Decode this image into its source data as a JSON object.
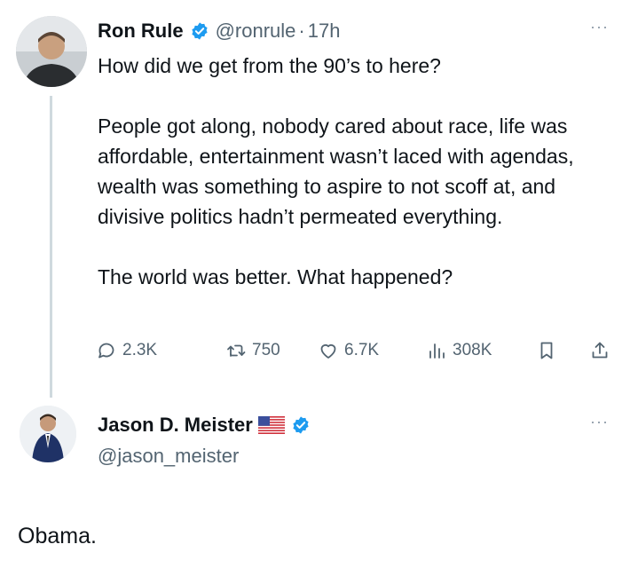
{
  "tweet": {
    "author_name": "Ron Rule",
    "author_handle": "@ronrule",
    "separator": "·",
    "time": "17h",
    "more": "···",
    "paragraphs": [
      "How did we get from the 90’s to here?",
      "People got along, nobody cared about race, life was affordable, entertainment wasn’t laced with agendas, wealth was something to aspire to not scoff at, and divisive politics hadn’t permeated everything.",
      "The world was better. What happened?"
    ],
    "actions": {
      "replies": "2.3K",
      "retweets": "750",
      "likes": "6.7K",
      "views": "308K"
    }
  },
  "reply": {
    "author_name": "Jason D. Meister",
    "author_handle": "@jason_meister",
    "more": "···",
    "text": "Obama."
  },
  "icons": {
    "verified": "verified-badge-icon",
    "flag": "us-flag-icon",
    "reply": "reply-icon",
    "retweet": "retweet-icon",
    "like": "heart-icon",
    "views": "views-icon",
    "bookmark": "bookmark-icon",
    "share": "share-icon"
  },
  "colors": {
    "text": "#0f1419",
    "secondary": "#536471",
    "verified_blue": "#1d9bf0",
    "thread_line": "#cfd9de"
  }
}
